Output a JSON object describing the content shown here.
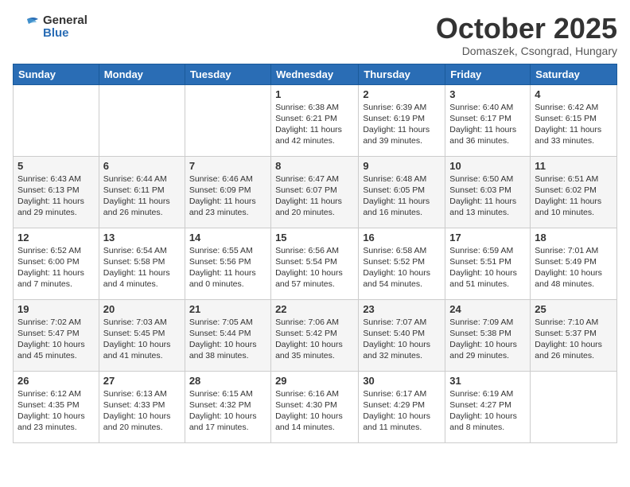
{
  "logo": {
    "general": "General",
    "blue": "Blue"
  },
  "title": "October 2025",
  "location": "Domaszek, Csongrad, Hungary",
  "days_of_week": [
    "Sunday",
    "Monday",
    "Tuesday",
    "Wednesday",
    "Thursday",
    "Friday",
    "Saturday"
  ],
  "weeks": [
    [
      {
        "day": "",
        "info": ""
      },
      {
        "day": "",
        "info": ""
      },
      {
        "day": "",
        "info": ""
      },
      {
        "day": "1",
        "info": "Sunrise: 6:38 AM\nSunset: 6:21 PM\nDaylight: 11 hours\nand 42 minutes."
      },
      {
        "day": "2",
        "info": "Sunrise: 6:39 AM\nSunset: 6:19 PM\nDaylight: 11 hours\nand 39 minutes."
      },
      {
        "day": "3",
        "info": "Sunrise: 6:40 AM\nSunset: 6:17 PM\nDaylight: 11 hours\nand 36 minutes."
      },
      {
        "day": "4",
        "info": "Sunrise: 6:42 AM\nSunset: 6:15 PM\nDaylight: 11 hours\nand 33 minutes."
      }
    ],
    [
      {
        "day": "5",
        "info": "Sunrise: 6:43 AM\nSunset: 6:13 PM\nDaylight: 11 hours\nand 29 minutes."
      },
      {
        "day": "6",
        "info": "Sunrise: 6:44 AM\nSunset: 6:11 PM\nDaylight: 11 hours\nand 26 minutes."
      },
      {
        "day": "7",
        "info": "Sunrise: 6:46 AM\nSunset: 6:09 PM\nDaylight: 11 hours\nand 23 minutes."
      },
      {
        "day": "8",
        "info": "Sunrise: 6:47 AM\nSunset: 6:07 PM\nDaylight: 11 hours\nand 20 minutes."
      },
      {
        "day": "9",
        "info": "Sunrise: 6:48 AM\nSunset: 6:05 PM\nDaylight: 11 hours\nand 16 minutes."
      },
      {
        "day": "10",
        "info": "Sunrise: 6:50 AM\nSunset: 6:03 PM\nDaylight: 11 hours\nand 13 minutes."
      },
      {
        "day": "11",
        "info": "Sunrise: 6:51 AM\nSunset: 6:02 PM\nDaylight: 11 hours\nand 10 minutes."
      }
    ],
    [
      {
        "day": "12",
        "info": "Sunrise: 6:52 AM\nSunset: 6:00 PM\nDaylight: 11 hours\nand 7 minutes."
      },
      {
        "day": "13",
        "info": "Sunrise: 6:54 AM\nSunset: 5:58 PM\nDaylight: 11 hours\nand 4 minutes."
      },
      {
        "day": "14",
        "info": "Sunrise: 6:55 AM\nSunset: 5:56 PM\nDaylight: 11 hours\nand 0 minutes."
      },
      {
        "day": "15",
        "info": "Sunrise: 6:56 AM\nSunset: 5:54 PM\nDaylight: 10 hours\nand 57 minutes."
      },
      {
        "day": "16",
        "info": "Sunrise: 6:58 AM\nSunset: 5:52 PM\nDaylight: 10 hours\nand 54 minutes."
      },
      {
        "day": "17",
        "info": "Sunrise: 6:59 AM\nSunset: 5:51 PM\nDaylight: 10 hours\nand 51 minutes."
      },
      {
        "day": "18",
        "info": "Sunrise: 7:01 AM\nSunset: 5:49 PM\nDaylight: 10 hours\nand 48 minutes."
      }
    ],
    [
      {
        "day": "19",
        "info": "Sunrise: 7:02 AM\nSunset: 5:47 PM\nDaylight: 10 hours\nand 45 minutes."
      },
      {
        "day": "20",
        "info": "Sunrise: 7:03 AM\nSunset: 5:45 PM\nDaylight: 10 hours\nand 41 minutes."
      },
      {
        "day": "21",
        "info": "Sunrise: 7:05 AM\nSunset: 5:44 PM\nDaylight: 10 hours\nand 38 minutes."
      },
      {
        "day": "22",
        "info": "Sunrise: 7:06 AM\nSunset: 5:42 PM\nDaylight: 10 hours\nand 35 minutes."
      },
      {
        "day": "23",
        "info": "Sunrise: 7:07 AM\nSunset: 5:40 PM\nDaylight: 10 hours\nand 32 minutes."
      },
      {
        "day": "24",
        "info": "Sunrise: 7:09 AM\nSunset: 5:38 PM\nDaylight: 10 hours\nand 29 minutes."
      },
      {
        "day": "25",
        "info": "Sunrise: 7:10 AM\nSunset: 5:37 PM\nDaylight: 10 hours\nand 26 minutes."
      }
    ],
    [
      {
        "day": "26",
        "info": "Sunrise: 6:12 AM\nSunset: 4:35 PM\nDaylight: 10 hours\nand 23 minutes."
      },
      {
        "day": "27",
        "info": "Sunrise: 6:13 AM\nSunset: 4:33 PM\nDaylight: 10 hours\nand 20 minutes."
      },
      {
        "day": "28",
        "info": "Sunrise: 6:15 AM\nSunset: 4:32 PM\nDaylight: 10 hours\nand 17 minutes."
      },
      {
        "day": "29",
        "info": "Sunrise: 6:16 AM\nSunset: 4:30 PM\nDaylight: 10 hours\nand 14 minutes."
      },
      {
        "day": "30",
        "info": "Sunrise: 6:17 AM\nSunset: 4:29 PM\nDaylight: 10 hours\nand 11 minutes."
      },
      {
        "day": "31",
        "info": "Sunrise: 6:19 AM\nSunset: 4:27 PM\nDaylight: 10 hours\nand 8 minutes."
      },
      {
        "day": "",
        "info": ""
      }
    ]
  ]
}
